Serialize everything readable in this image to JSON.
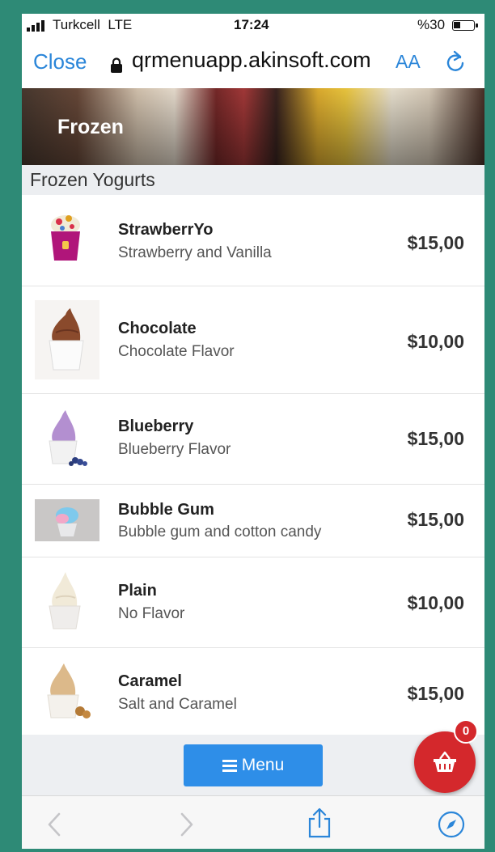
{
  "status": {
    "carrier": "Turkcell",
    "network": "LTE",
    "time": "17:24",
    "battery": "%30"
  },
  "browser": {
    "close_label": "Close",
    "url": "qrmenuapp.akinsoft.com",
    "text_size_label": "AA"
  },
  "banner": {
    "title": "Frozen"
  },
  "section": {
    "title": "Frozen Yogurts"
  },
  "items": [
    {
      "name": "StrawberrYo",
      "description": "Strawberry and Vanilla",
      "price": "$15,00"
    },
    {
      "name": "Chocolate",
      "description": "Chocolate Flavor",
      "price": "$10,00"
    },
    {
      "name": "Blueberry",
      "description": "Blueberry Flavor",
      "price": "$15,00"
    },
    {
      "name": "Bubble Gum",
      "description": "Bubble gum and cotton candy",
      "price": "$15,00"
    },
    {
      "name": "Plain",
      "description": "No Flavor",
      "price": "$10,00"
    },
    {
      "name": "Caramel",
      "description": "Salt and Caramel",
      "price": "$15,00"
    }
  ],
  "menu_button": {
    "label": "Menu"
  },
  "cart": {
    "count": "0"
  },
  "colors": {
    "frame": "#2e8a76",
    "accent": "#2e8ee8",
    "cart": "#d4282c",
    "link": "#2b86d9"
  },
  "icons": {
    "lock": "lock-icon",
    "reload": "reload-icon",
    "menu": "hamburger-icon",
    "cart": "basket-icon",
    "back": "chevron-left-icon",
    "forward": "chevron-right-icon",
    "share": "share-icon",
    "compass": "compass-icon"
  }
}
